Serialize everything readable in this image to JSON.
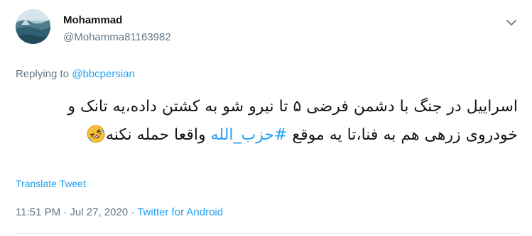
{
  "author": {
    "display_name": "Mohammad",
    "handle": "@Mohamma81163982"
  },
  "reply": {
    "prefix": "Replying to ",
    "to": "@bbcpersian"
  },
  "tweet": {
    "text_before_hashtag": "اسراییل در جنگ با دشمن فرضی ۵ تا نیرو شو به کشتن داده،یه تانک و خودروی زرهی هم به فنا،تا یه موقع ",
    "hashtag": "#حزب_الله",
    "text_after_hashtag": " واقعا حمله نکنه",
    "emoji_icon": "rolling-on-floor-laughing-emoji"
  },
  "translate_label": "Translate Tweet",
  "meta": {
    "timestamp": "11:51 PM · Jul 27, 2020 · ",
    "source": "Twitter for Android"
  },
  "colors": {
    "link": "#1da1f2",
    "secondary_text": "#657786",
    "primary_text": "#14171a"
  }
}
